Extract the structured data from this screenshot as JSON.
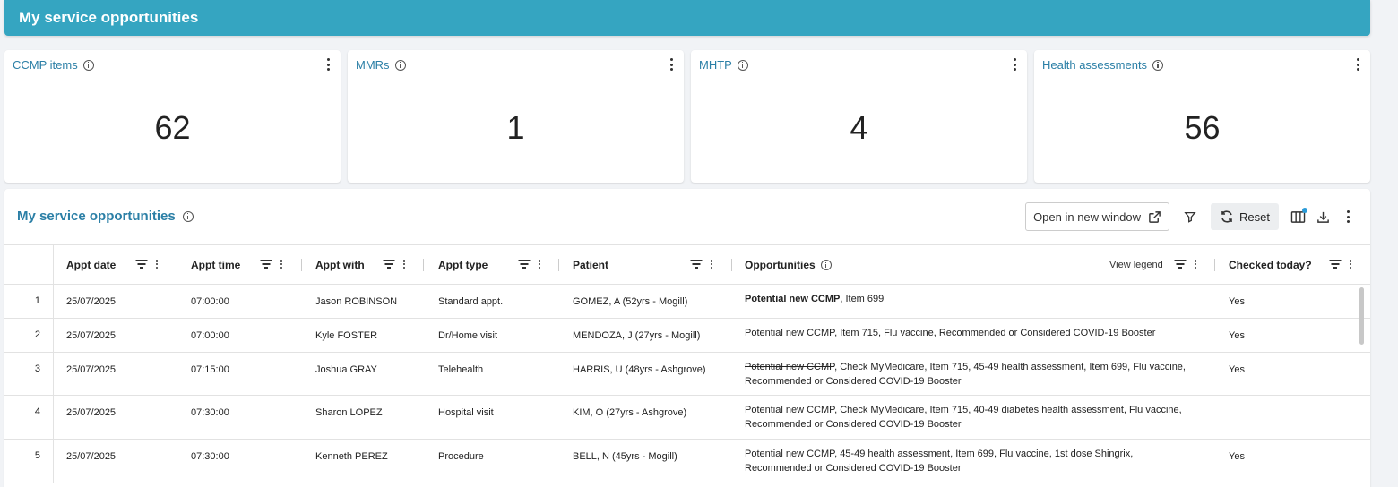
{
  "banner": {
    "title": "My service opportunities"
  },
  "cards": [
    {
      "title": "CCMP items",
      "value": "62"
    },
    {
      "title": "MMRs",
      "value": "1"
    },
    {
      "title": "MHTP",
      "value": "4"
    },
    {
      "title": "Health assessments",
      "value": "56"
    }
  ],
  "panel": {
    "title": "My service opportunities",
    "toolbar": {
      "open_window_label": "Open in new window",
      "reset_label": "Reset"
    }
  },
  "table": {
    "columns": {
      "appt_date": "Appt date",
      "appt_time": "Appt time",
      "appt_with": "Appt with",
      "appt_type": "Appt type",
      "patient": "Patient",
      "opportunities": "Opportunities",
      "view_legend": "View legend",
      "checked_today": "Checked today?"
    },
    "rows": [
      {
        "num": "1",
        "date": "25/07/2025",
        "time": "07:00:00",
        "with": "Jason ROBINSON",
        "type": "Standard appt.",
        "patient": "GOMEZ, A (52yrs - Mogill)",
        "opp_lead": "Potential new CCMP",
        "opp_rest": ", Item 699",
        "checked": "Yes"
      },
      {
        "num": "2",
        "date": "25/07/2025",
        "time": "07:00:00",
        "with": "Kyle FOSTER",
        "type": "Dr/Home visit",
        "patient": "MENDOZA, J (27yrs - Mogill)",
        "opp_lead": "Potential new CCMP",
        "opp_rest": ", Item 715, Flu vaccine, Recommended or Considered COVID-19 Booster",
        "checked": "Yes"
      },
      {
        "num": "3",
        "date": "25/07/2025",
        "time": "07:15:00",
        "with": "Joshua GRAY",
        "type": "Telehealth",
        "patient": "HARRIS, U (48yrs - Ashgrove)",
        "opp_lead": "Potential new CCMP",
        "opp_rest": ", Check MyMedicare, Item 715, 45-49 health assessment, Item 699, Flu vaccine, Recommended or Considered COVID-19 Booster",
        "checked": "Yes"
      },
      {
        "num": "4",
        "date": "25/07/2025",
        "time": "07:30:00",
        "with": "Sharon LOPEZ",
        "type": "Hospital visit",
        "patient": "KIM, O (27yrs - Ashgrove)",
        "opp_lead": "Potential new CCMP",
        "opp_rest": ", Check MyMedicare, Item 715, 40-49 diabetes health assessment, Flu vaccine, Recommended or Considered COVID-19 Booster",
        "checked": ""
      },
      {
        "num": "5",
        "date": "25/07/2025",
        "time": "07:30:00",
        "with": "Kenneth PEREZ",
        "type": "Procedure",
        "patient": "BELL, N (45yrs - Mogill)",
        "opp_lead": "Potential new CCMP",
        "opp_rest": ", 45-49 health assessment, Item 699, Flu vaccine, 1st dose Shingrix, Recommended or Considered COVID-19 Booster",
        "checked": "Yes"
      }
    ]
  }
}
